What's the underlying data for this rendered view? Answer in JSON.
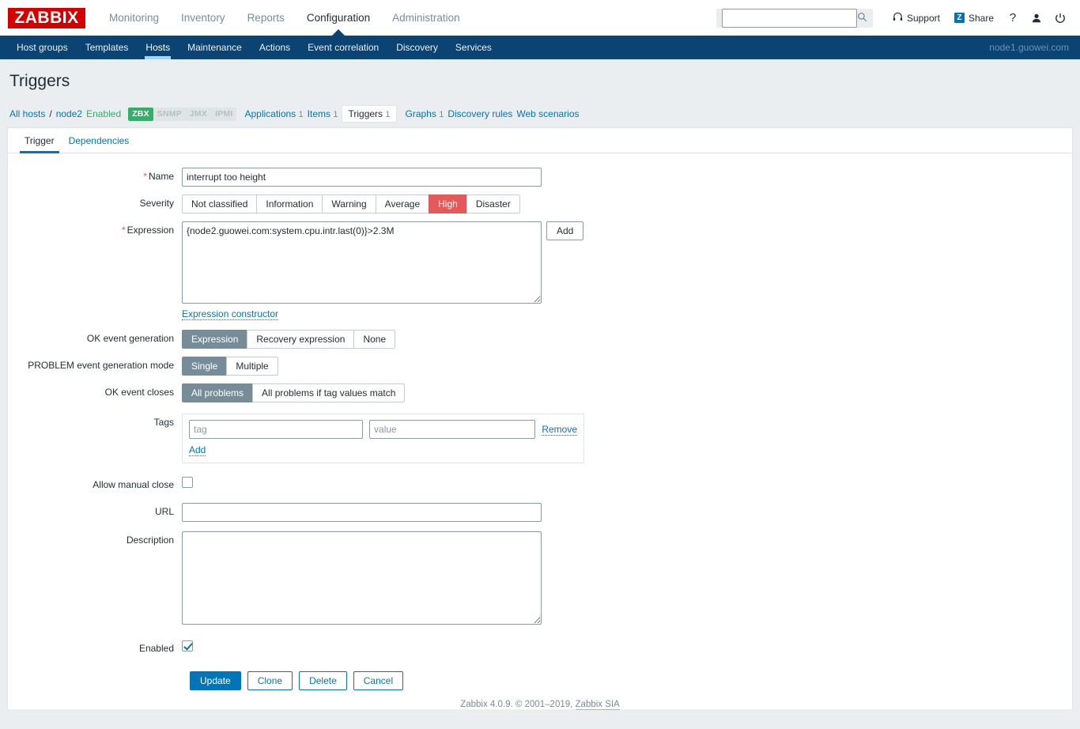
{
  "header": {
    "logo_text": "ZABBIX",
    "logo_color": "#d40000",
    "menu": [
      {
        "label": "Monitoring",
        "active": false
      },
      {
        "label": "Inventory",
        "active": false
      },
      {
        "label": "Reports",
        "active": false
      },
      {
        "label": "Configuration",
        "active": true
      },
      {
        "label": "Administration",
        "active": false
      }
    ],
    "search": {
      "value": "",
      "placeholder": ""
    },
    "support_label": "Support",
    "share_label": "Share",
    "share_badge": "Z",
    "help_label": "?",
    "accent_color": "#0275b8"
  },
  "subnav": {
    "items": [
      {
        "label": "Host groups",
        "active": false
      },
      {
        "label": "Templates",
        "active": false
      },
      {
        "label": "Hosts",
        "active": true
      },
      {
        "label": "Maintenance",
        "active": false
      },
      {
        "label": "Actions",
        "active": false
      },
      {
        "label": "Event correlation",
        "active": false
      },
      {
        "label": "Discovery",
        "active": false
      },
      {
        "label": "Services",
        "active": false
      }
    ],
    "host_label": "node1.guowei.com",
    "bg_color": "#0b4372"
  },
  "page": {
    "title": "Triggers"
  },
  "breadcrumb": {
    "all_hosts": "All hosts",
    "separator": "/",
    "host": "node2",
    "status": "Enabled",
    "interfaces": [
      {
        "label": "ZBX",
        "enabled": true
      },
      {
        "label": "SNMP",
        "enabled": false
      },
      {
        "label": "JMX",
        "enabled": false
      },
      {
        "label": "IPMI",
        "enabled": false
      }
    ],
    "links": [
      {
        "label": "Applications",
        "count": "1",
        "current": false
      },
      {
        "label": "Items",
        "count": "1",
        "current": false
      },
      {
        "label": "Triggers",
        "count": "1",
        "current": true
      },
      {
        "label": "Graphs",
        "count": "1",
        "current": false
      },
      {
        "label": "Discovery rules",
        "count": "",
        "current": false
      },
      {
        "label": "Web scenarios",
        "count": "",
        "current": false
      }
    ]
  },
  "tabs": [
    {
      "label": "Trigger",
      "active": true
    },
    {
      "label": "Dependencies",
      "active": false
    }
  ],
  "form": {
    "name": {
      "label": "Name",
      "required": true,
      "value": "interrupt too height",
      "placeholder": ""
    },
    "severity": {
      "label": "Severity",
      "options": [
        {
          "label": "Not classified",
          "selected": false
        },
        {
          "label": "Information",
          "selected": false
        },
        {
          "label": "Warning",
          "selected": false
        },
        {
          "label": "Average",
          "selected": false
        },
        {
          "label": "High",
          "selected": true
        },
        {
          "label": "Disaster",
          "selected": false
        }
      ],
      "selected_color": "#e45959"
    },
    "expression": {
      "label": "Expression",
      "required": true,
      "value": "{node2.guowei.com:system.cpu.intr.last(0)}>2.3M",
      "placeholder": "",
      "add_button": "Add",
      "constructor_link": "Expression constructor"
    },
    "ok_event_generation": {
      "label": "OK event generation",
      "options": [
        {
          "label": "Expression",
          "selected": true
        },
        {
          "label": "Recovery expression",
          "selected": false
        },
        {
          "label": "None",
          "selected": false
        }
      ]
    },
    "problem_event_generation_mode": {
      "label": "PROBLEM event generation mode",
      "options": [
        {
          "label": "Single",
          "selected": true
        },
        {
          "label": "Multiple",
          "selected": false
        }
      ]
    },
    "ok_event_closes": {
      "label": "OK event closes",
      "options": [
        {
          "label": "All problems",
          "selected": true
        },
        {
          "label": "All problems if tag values match",
          "selected": false
        }
      ]
    },
    "tags": {
      "label": "Tags",
      "rows": [
        {
          "tag_value": "",
          "tag_placeholder": "tag",
          "value_value": "",
          "value_placeholder": "value",
          "remove_label": "Remove"
        }
      ],
      "add_label": "Add"
    },
    "allow_manual_close": {
      "label": "Allow manual close",
      "checked": false
    },
    "url": {
      "label": "URL",
      "value": "",
      "placeholder": ""
    },
    "description": {
      "label": "Description",
      "value": "",
      "placeholder": ""
    },
    "enabled": {
      "label": "Enabled",
      "checked": true
    },
    "buttons": [
      {
        "label": "Update",
        "kind": "primary"
      },
      {
        "label": "Clone",
        "kind": "secondary"
      },
      {
        "label": "Delete",
        "kind": "secondary"
      },
      {
        "label": "Cancel",
        "kind": "secondary"
      }
    ]
  },
  "footer": {
    "text": "Zabbix 4.0.9. © 2001–2019, ",
    "link": "Zabbix SIA"
  }
}
